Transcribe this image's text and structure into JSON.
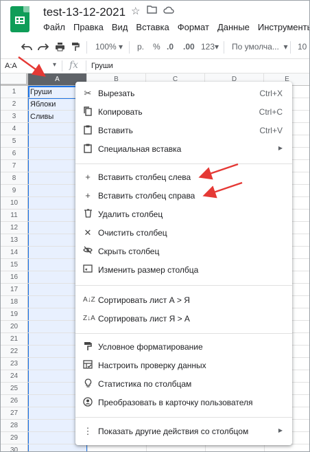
{
  "app": {
    "doc_title": "test-13-12-2021",
    "menu": [
      "Файл",
      "Правка",
      "Вид",
      "Вставка",
      "Формат",
      "Данные",
      "Инструменты"
    ]
  },
  "toolbar": {
    "zoom": "100%",
    "currency": "р.",
    "percent": "%",
    "dec_less": ".0",
    "dec_more": ".00",
    "num_format": "123",
    "font": "По умолча...",
    "font_size": "10"
  },
  "formula_bar": {
    "name_box": "A:A",
    "fx_symbol": "fx",
    "value": "Груши"
  },
  "grid": {
    "columns": [
      "A",
      "B",
      "C",
      "D",
      "E"
    ],
    "rows": [
      "1",
      "2",
      "3",
      "4",
      "5",
      "6",
      "7",
      "8",
      "9",
      "10",
      "11",
      "12",
      "13",
      "14",
      "15",
      "16",
      "17",
      "18",
      "19",
      "20",
      "21",
      "22",
      "23",
      "24",
      "25",
      "26",
      "27",
      "28",
      "29",
      "30"
    ],
    "cells": [
      "Груши",
      "Яблоки",
      "Сливы"
    ]
  },
  "context_menu": {
    "group1": [
      {
        "label": "Вырезать",
        "shortcut": "Ctrl+X",
        "icon": "scissors-icon"
      },
      {
        "label": "Копировать",
        "shortcut": "Ctrl+C",
        "icon": "copy-icon"
      },
      {
        "label": "Вставить",
        "shortcut": "Ctrl+V",
        "icon": "paste-icon"
      },
      {
        "label": "Специальная вставка",
        "shortcut": "",
        "icon": "paste-special-icon"
      }
    ],
    "group2": [
      {
        "label": "Вставить столбец слева",
        "icon": "plus-icon"
      },
      {
        "label": "Вставить столбец справа",
        "icon": "plus-icon"
      },
      {
        "label": "Удалить столбец",
        "icon": "trash-icon"
      },
      {
        "label": "Очистить столбец",
        "icon": "close-icon"
      },
      {
        "label": "Скрыть столбец",
        "icon": "eye-off-icon"
      },
      {
        "label": "Изменить размер столбца",
        "icon": "resize-icon"
      }
    ],
    "group3": [
      {
        "label": "Сортировать лист А > Я",
        "icon": "sort-az-icon"
      },
      {
        "label": "Сортировать лист Я > А",
        "icon": "sort-za-icon"
      }
    ],
    "group4": [
      {
        "label": "Условное форматирование",
        "icon": "paint-roller-icon"
      },
      {
        "label": "Настроить проверку данных",
        "icon": "data-validation-icon"
      },
      {
        "label": "Статистика по столбцам",
        "icon": "lightbulb-icon"
      },
      {
        "label": "Преобразовать в карточку пользователя",
        "icon": "person-card-icon"
      }
    ],
    "group5": [
      {
        "label": "Показать другие действия со столбцом",
        "icon": "more-vert-icon"
      }
    ]
  },
  "colors": {
    "accent": "#1a73e8",
    "selection_fill": "#e8f0fe",
    "annotation_arrow": "#e53935",
    "sheets_green": "#0f9d58"
  }
}
